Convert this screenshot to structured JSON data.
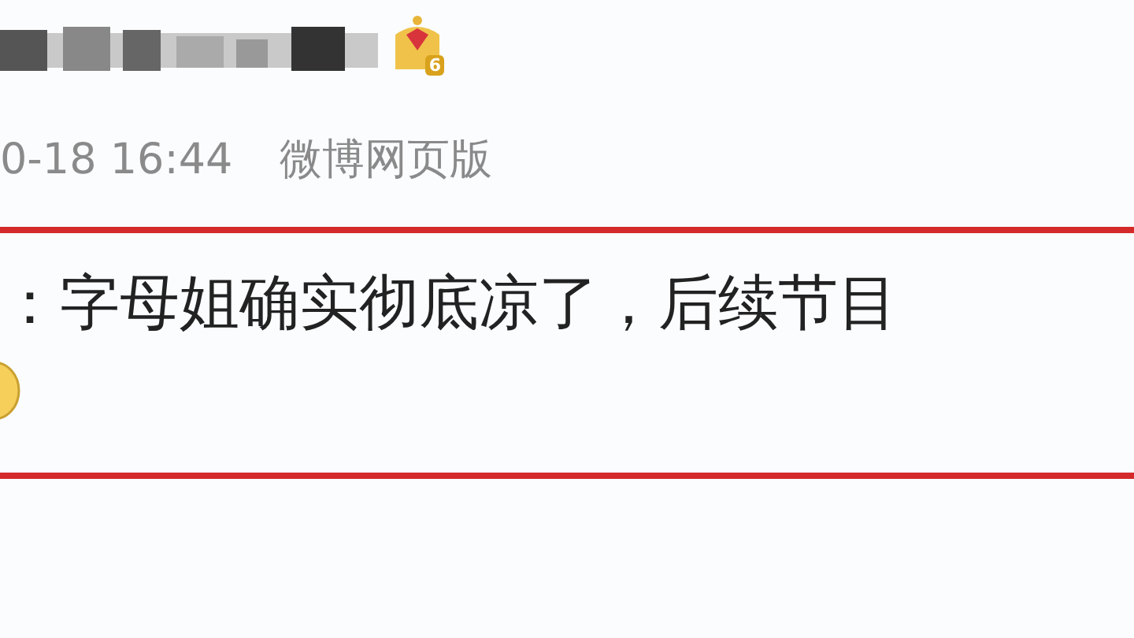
{
  "post": {
    "author_badge": {
      "level": "6"
    },
    "meta": {
      "time": "0-18 16:44",
      "source": "微博网页版"
    },
    "text": "：字母姐确实彻底凉了，后续节目"
  }
}
